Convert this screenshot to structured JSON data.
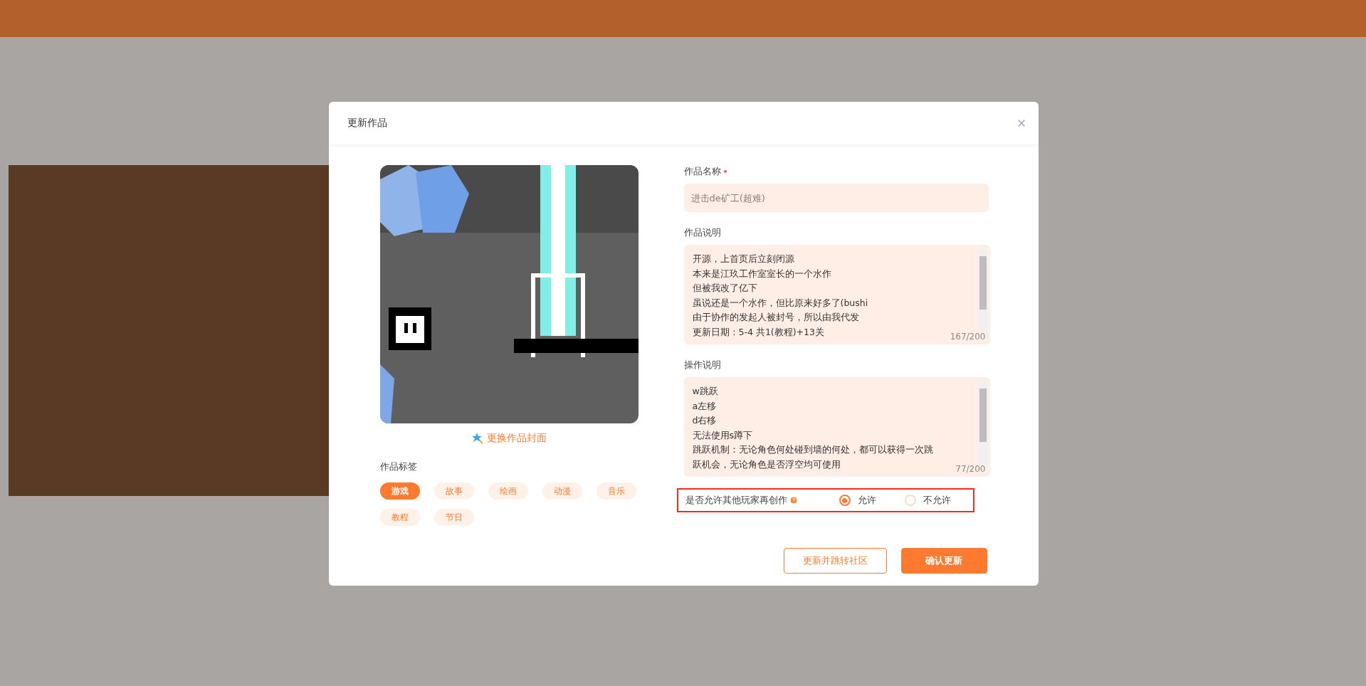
{
  "dialog": {
    "title": "更新作品"
  },
  "cover": {
    "change_link": "更换作品封面"
  },
  "tags": {
    "label": "作品标签",
    "items": [
      {
        "label": "游戏",
        "selected": true
      },
      {
        "label": "故事",
        "selected": false
      },
      {
        "label": "绘画",
        "selected": false
      },
      {
        "label": "动漫",
        "selected": false
      },
      {
        "label": "音乐",
        "selected": false
      },
      {
        "label": "教程",
        "selected": false
      },
      {
        "label": "节日",
        "selected": false
      }
    ]
  },
  "name_field": {
    "label": "作品名称",
    "required": true,
    "placeholder": "进击de矿工(超难)"
  },
  "description_field": {
    "label": "作品说明",
    "lines": [
      "开源，上首页后立刻闭源",
      "本来是江玖工作室室长的一个水作",
      "但被我改了亿下",
      "虽说还是一个水作，但比原来好多了(bushi",
      "由于协作的发起人被封号，所以由我代发",
      "更新日期：5-4 共1(教程)+13关"
    ],
    "counter": "167/200"
  },
  "operation_field": {
    "label": "操作说明",
    "lines": [
      "w跳跃",
      "a左移",
      "d右移",
      "无法使用s蹲下",
      "跳跃机制：无论角色何处碰到墙的何处，都可以获得一次跳",
      "跃机会，无论角色是否浮空均可使用"
    ],
    "counter": "77/200"
  },
  "remix": {
    "label": "是否允许其他玩家再创作",
    "options": [
      {
        "label": "允许",
        "selected": true
      },
      {
        "label": "不允许",
        "selected": false
      }
    ]
  },
  "buttons": [
    {
      "label": "更新并跳转社区",
      "kind": "outline"
    },
    {
      "label": "确认更新",
      "kind": "primary"
    }
  ]
}
